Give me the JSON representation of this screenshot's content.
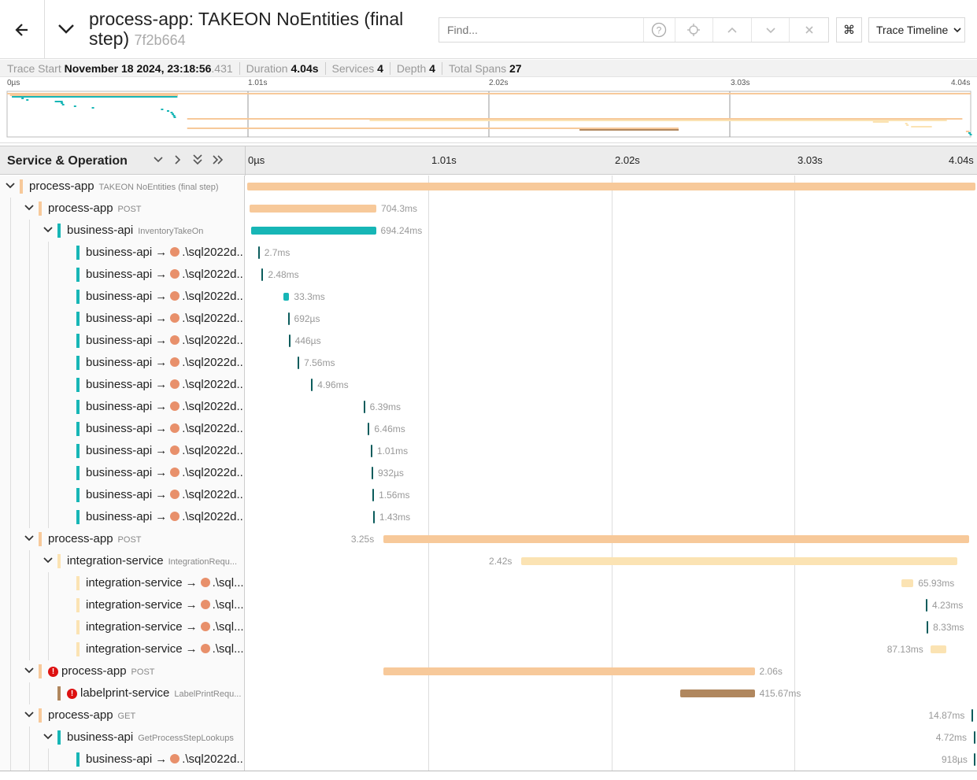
{
  "header": {
    "title": "process-app: TAKEON NoEntities (final step)",
    "trace_id": "7f2b664",
    "search_placeholder": "Find...",
    "kbd_label": "⌘",
    "view_select": "Trace Timeline"
  },
  "meta": {
    "trace_start_label": "Trace Start",
    "trace_start_value": "November 18 2024, 23:18:56",
    "trace_start_ms": ".431",
    "duration_label": "Duration",
    "duration_value": "4.04s",
    "services_label": "Services",
    "services_value": "4",
    "depth_label": "Depth",
    "depth_value": "4",
    "total_spans_label": "Total Spans",
    "total_spans_value": "27"
  },
  "minimap": {
    "ticks": [
      "0µs",
      "1.01s",
      "2.02s",
      "3.03s",
      "4.04s"
    ]
  },
  "table": {
    "service_operation_label": "Service & Operation",
    "ticks": [
      "0µs",
      "1.01s",
      "2.02s",
      "3.03s",
      "4.04s"
    ]
  },
  "colors": {
    "process_app": "#f7c99a",
    "business_api": "#17b6b6",
    "integration_service": "#fbe3b3",
    "labelprint_service": "#b0875e",
    "error": "#dd1111"
  },
  "rows": [
    {
      "depth": 0,
      "toggle": "expanded",
      "service": "process-app",
      "op": "TAKEON NoEntities (final step)",
      "color": "process_app",
      "error": false,
      "db": false,
      "duration": "",
      "start_s": 0,
      "dur_s": 4.04
    },
    {
      "depth": 1,
      "toggle": "expanded",
      "service": "process-app",
      "op": "POST",
      "color": "process_app",
      "error": false,
      "db": false,
      "duration": "704.3ms",
      "start_s": 0.012,
      "dur_s": 0.7043
    },
    {
      "depth": 2,
      "toggle": "expanded",
      "service": "business-api",
      "op": "InventoryTakeOn",
      "color": "business_api",
      "error": false,
      "db": false,
      "duration": "694.24ms",
      "start_s": 0.02,
      "dur_s": 0.69424
    },
    {
      "depth": 3,
      "toggle": "none",
      "service": "business-api",
      "target": ".\\sql2022d...",
      "color": "business_api",
      "error": false,
      "db": true,
      "duration": "2.7ms",
      "start_s": 0.06,
      "dur_s": 0.0027
    },
    {
      "depth": 3,
      "toggle": "none",
      "service": "business-api",
      "target": ".\\sql2022d...",
      "color": "business_api",
      "error": false,
      "db": true,
      "duration": "2.48ms",
      "start_s": 0.08,
      "dur_s": 0.00248
    },
    {
      "depth": 3,
      "toggle": "none",
      "service": "business-api",
      "target": ".\\sql2022d...",
      "color": "business_api",
      "error": false,
      "db": true,
      "duration": "33.3ms",
      "start_s": 0.2,
      "dur_s": 0.0333
    },
    {
      "depth": 3,
      "toggle": "none",
      "service": "business-api",
      "target": ".\\sql2022d...",
      "color": "business_api",
      "error": false,
      "db": true,
      "duration": "692µs",
      "start_s": 0.225,
      "dur_s": 0.000692
    },
    {
      "depth": 3,
      "toggle": "none",
      "service": "business-api",
      "target": ".\\sql2022d...",
      "color": "business_api",
      "error": false,
      "db": true,
      "duration": "446µs",
      "start_s": 0.23,
      "dur_s": 0.000446
    },
    {
      "depth": 3,
      "toggle": "none",
      "service": "business-api",
      "target": ".\\sql2022d...",
      "color": "business_api",
      "error": false,
      "db": true,
      "duration": "7.56ms",
      "start_s": 0.28,
      "dur_s": 0.00756
    },
    {
      "depth": 3,
      "toggle": "none",
      "service": "business-api",
      "target": ".\\sql2022d...",
      "color": "business_api",
      "error": false,
      "db": true,
      "duration": "4.96ms",
      "start_s": 0.355,
      "dur_s": 0.00496
    },
    {
      "depth": 3,
      "toggle": "none",
      "service": "business-api",
      "target": ".\\sql2022d...",
      "color": "business_api",
      "error": false,
      "db": true,
      "duration": "6.39ms",
      "start_s": 0.645,
      "dur_s": 0.00639
    },
    {
      "depth": 3,
      "toggle": "none",
      "service": "business-api",
      "target": ".\\sql2022d...",
      "color": "business_api",
      "error": false,
      "db": true,
      "duration": "6.46ms",
      "start_s": 0.67,
      "dur_s": 0.00646
    },
    {
      "depth": 3,
      "toggle": "none",
      "service": "business-api",
      "target": ".\\sql2022d...",
      "color": "business_api",
      "error": false,
      "db": true,
      "duration": "1.01ms",
      "start_s": 0.685,
      "dur_s": 0.00101
    },
    {
      "depth": 3,
      "toggle": "none",
      "service": "business-api",
      "target": ".\\sql2022d...",
      "color": "business_api",
      "error": false,
      "db": true,
      "duration": "932µs",
      "start_s": 0.69,
      "dur_s": 0.000932
    },
    {
      "depth": 3,
      "toggle": "none",
      "service": "business-api",
      "target": ".\\sql2022d...",
      "color": "business_api",
      "error": false,
      "db": true,
      "duration": "1.56ms",
      "start_s": 0.695,
      "dur_s": 0.00156
    },
    {
      "depth": 3,
      "toggle": "none",
      "service": "business-api",
      "target": ".\\sql2022d...",
      "color": "business_api",
      "error": false,
      "db": true,
      "duration": "1.43ms",
      "start_s": 0.698,
      "dur_s": 0.00143
    },
    {
      "depth": 1,
      "toggle": "expanded",
      "service": "process-app",
      "op": "POST",
      "color": "process_app",
      "error": false,
      "db": false,
      "duration": "3.25s",
      "start_s": 0.755,
      "dur_s": 3.25
    },
    {
      "depth": 2,
      "toggle": "expanded",
      "service": "integration-service",
      "op": "IntegrationRequ...",
      "color": "integration_service",
      "error": false,
      "db": false,
      "duration": "2.42s",
      "start_s": 1.52,
      "dur_s": 2.42
    },
    {
      "depth": 3,
      "toggle": "none",
      "service": "integration-service",
      "target": ".\\sql...",
      "color": "integration_service",
      "error": false,
      "db": true,
      "duration": "65.93ms",
      "start_s": 3.63,
      "dur_s": 0.06593
    },
    {
      "depth": 3,
      "toggle": "none",
      "service": "integration-service",
      "target": ".\\sql...",
      "color": "integration_service",
      "error": false,
      "db": true,
      "duration": "4.23ms",
      "start_s": 3.765,
      "dur_s": 0.00423
    },
    {
      "depth": 3,
      "toggle": "none",
      "service": "integration-service",
      "target": ".\\sql...",
      "color": "integration_service",
      "error": false,
      "db": true,
      "duration": "8.33ms",
      "start_s": 3.77,
      "dur_s": 0.00833
    },
    {
      "depth": 3,
      "toggle": "none",
      "service": "integration-service",
      "target": ".\\sql...",
      "color": "integration_service",
      "error": false,
      "db": true,
      "duration": "87.13ms",
      "start_s": 3.79,
      "dur_s": 0.08713
    },
    {
      "depth": 1,
      "toggle": "expanded",
      "service": "process-app",
      "op": "POST",
      "color": "process_app",
      "error": true,
      "db": false,
      "duration": "2.06s",
      "start_s": 0.755,
      "dur_s": 2.06
    },
    {
      "depth": 2,
      "toggle": "none",
      "service": "labelprint-service",
      "op": "LabelPrintRequ...",
      "color": "labelprint_service",
      "error": true,
      "db": false,
      "duration": "415.67ms",
      "start_s": 2.4,
      "dur_s": 0.41567
    },
    {
      "depth": 1,
      "toggle": "expanded",
      "service": "process-app",
      "op": "GET",
      "color": "process_app",
      "error": false,
      "db": false,
      "duration": "14.87ms",
      "start_s": 4.02,
      "dur_s": 0.01487
    },
    {
      "depth": 2,
      "toggle": "expanded",
      "service": "business-api",
      "op": "GetProcessStepLookups",
      "color": "business_api",
      "error": false,
      "db": false,
      "duration": "4.72ms",
      "start_s": 4.03,
      "dur_s": 0.00472
    },
    {
      "depth": 3,
      "toggle": "none",
      "service": "business-api",
      "target": ".\\sql2022d...",
      "color": "business_api",
      "error": false,
      "db": true,
      "duration": "918µs",
      "start_s": 4.035,
      "dur_s": 0.000918
    }
  ]
}
